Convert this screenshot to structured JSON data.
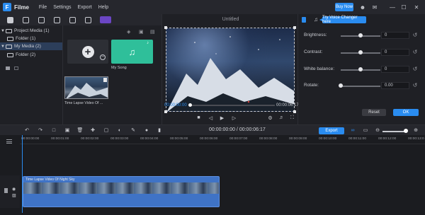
{
  "app": {
    "name": "Filme",
    "menu": [
      "File",
      "Settings",
      "Export",
      "Help"
    ],
    "buy_now": "Buy Now"
  },
  "media": {
    "tree": [
      {
        "label": "Project Media (1)"
      },
      {
        "label": "Folder (1)"
      },
      {
        "label": "My Media (2)"
      },
      {
        "label": "Folder (2)"
      }
    ],
    "song_label": "My Song",
    "video_label": "Time Lapse Video Of ..."
  },
  "preview": {
    "title": "Untitled",
    "current_time": "00:00:00:00",
    "total_time": "00:00:06:17"
  },
  "properties": {
    "tooltip": "Try Voice Changer here",
    "rows": [
      {
        "label": "Brightness:",
        "value": "0",
        "level": 0.5
      },
      {
        "label": "Contrast:",
        "value": "0",
        "level": 0.5
      },
      {
        "label": "White balance:",
        "value": "0",
        "level": 0.5
      },
      {
        "label": "Rotate:",
        "value": "0.00",
        "level": 0.0
      }
    ],
    "reset": "Reset",
    "ok": "OK"
  },
  "timeline": {
    "time_readout": "00:00:00:00  / 00:00:06:17",
    "export": "Export",
    "ruler": [
      "00:00:00:00",
      "00:00:01:00",
      "00:00:02:00",
      "00:00:03:00",
      "00:00:04:00",
      "00:00:05:00",
      "00:00:06:00",
      "00:00:07:00",
      "00:00:08:00",
      "00:00:09:00",
      "00:00:10:00",
      "00:00:11:00",
      "00:00:12:00",
      "00:00:13:0"
    ],
    "clip_title": "Time Lapse Video Of Night Sky"
  },
  "colors": {
    "accent": "#2a8cf0",
    "clip": "#3f73c6",
    "song": "#2fbf9a"
  }
}
